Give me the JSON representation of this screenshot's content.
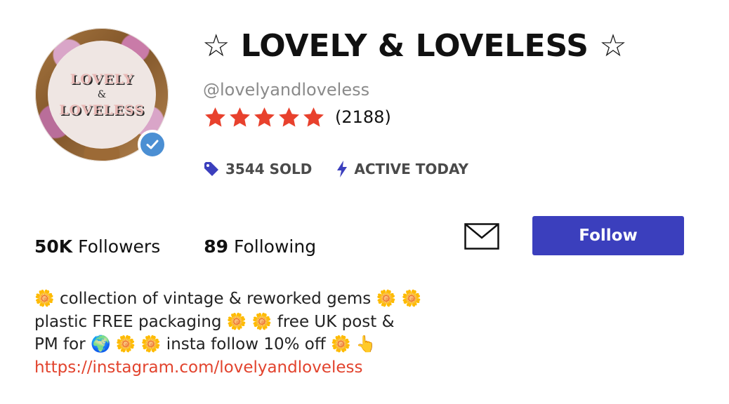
{
  "profile": {
    "avatar": {
      "logo_top": "LOVELY",
      "logo_amp": "&",
      "logo_bottom": "LOVELESS",
      "verified_icon": "check-circle-icon"
    },
    "title": "☆ LOVELY & LOVELESS ☆",
    "handle": "@lovelyandloveless",
    "rating": {
      "stars_filled": 5,
      "stars_total": 5,
      "star_color": "#e8412d",
      "review_count": "(2188)"
    },
    "meta": {
      "sold": "3544 SOLD",
      "sold_icon": "price-tag-icon",
      "activity": "ACTIVE TODAY",
      "activity_icon": "lightning-bolt-icon",
      "icon_color": "#3b3fbd"
    }
  },
  "stats": {
    "followers_count": "50K",
    "followers_label": "Followers",
    "following_count": "89",
    "following_label": "Following"
  },
  "actions": {
    "message_icon": "envelope-icon",
    "follow_label": "Follow",
    "follow_color": "#3b3fbd"
  },
  "bio": {
    "line1": "🌼 collection of vintage & reworked gems 🌼 🌼",
    "line2": "plastic FREE packaging 🌼 🌼 free UK post &",
    "line3": "PM for 🌍 🌼 🌼 insta follow 10% off 🌼 👆",
    "link": "https://instagram.com/lovelyandloveless",
    "link_color": "#e2432d"
  }
}
